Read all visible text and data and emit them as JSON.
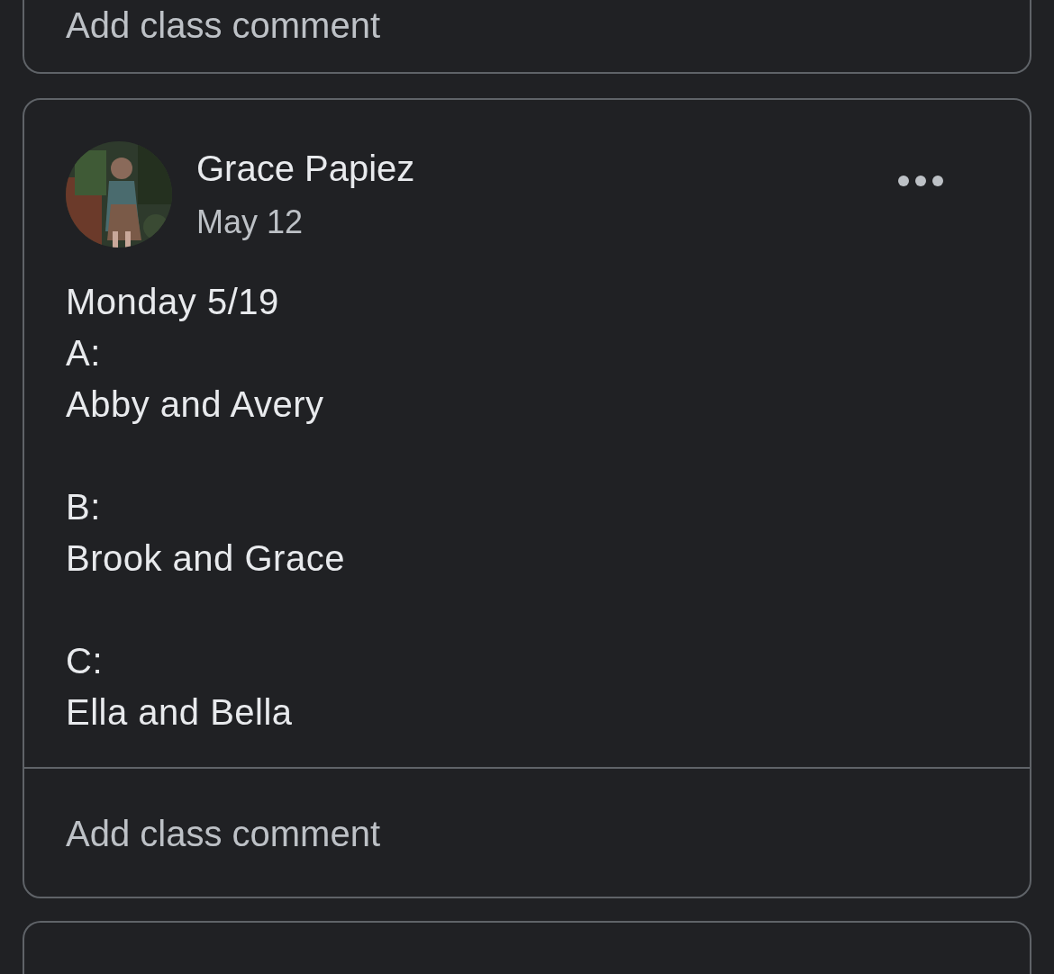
{
  "previous_post": {
    "comment_placeholder": "Add class comment"
  },
  "post": {
    "author": "Grace Papiez",
    "date": "May 12",
    "text": "Monday 5/19\nA:\nAbby and Avery\n\nB:\nBrook and Grace\n\nC:\nElla and Bella",
    "comment_placeholder": "Add class comment"
  }
}
